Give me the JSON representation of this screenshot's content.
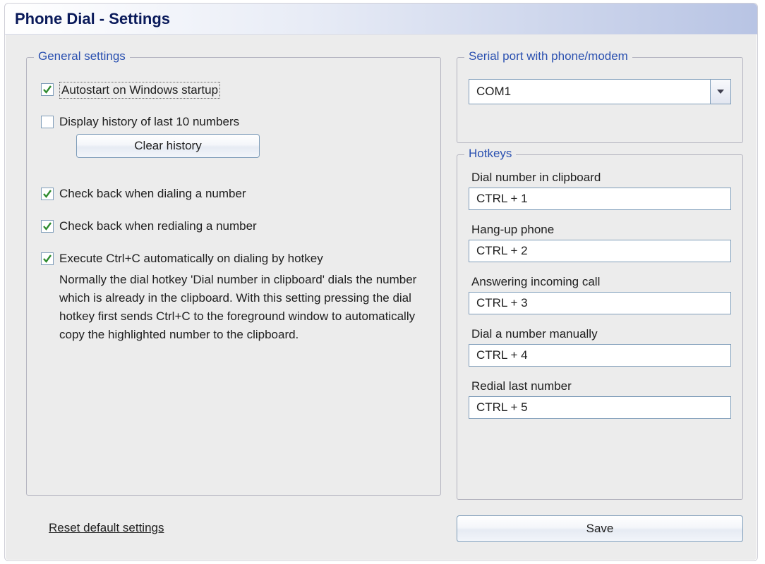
{
  "window": {
    "title": "Phone Dial - Settings"
  },
  "general": {
    "legend": "General settings",
    "autostart_label": "Autostart on Windows startup",
    "autostart_checked": true,
    "display_history_label": "Display history of last 10 numbers",
    "display_history_checked": false,
    "clear_history_button": "Clear history",
    "check_back_dial_label": "Check back when dialing a number",
    "check_back_dial_checked": true,
    "check_back_redial_label": "Check back when redialing a number",
    "check_back_redial_checked": true,
    "exec_ctrl_c_label": "Execute Ctrl+C automatically on dialing by hotkey",
    "exec_ctrl_c_checked": true,
    "exec_ctrl_c_desc": "Normally the dial hotkey 'Dial number in clipboard' dials the number which is already in the clipboard. With this setting pressing the dial hotkey first sends Ctrl+C to the foreground window to automatically copy the highlighted number to the clipboard."
  },
  "serial": {
    "legend": "Serial port with phone/modem",
    "value": "COM1"
  },
  "hotkeys": {
    "legend": "Hotkeys",
    "rows": [
      {
        "label": "Dial number in clipboard",
        "value": "CTRL + 1"
      },
      {
        "label": "Hang-up phone",
        "value": "CTRL + 2"
      },
      {
        "label": "Answering incoming call",
        "value": "CTRL + 3"
      },
      {
        "label": "Dial a number manually",
        "value": "CTRL + 4"
      },
      {
        "label": "Redial last number",
        "value": "CTRL + 5"
      }
    ]
  },
  "footer": {
    "reset_label": "Reset default settings",
    "save_label": "Save"
  }
}
